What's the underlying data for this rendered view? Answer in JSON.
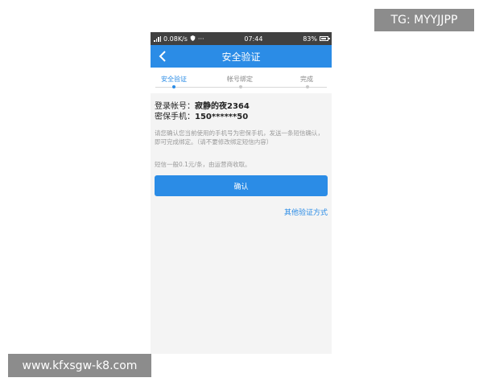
{
  "watermarks": {
    "tg": "TG: MYYJJPP",
    "site": "www.kfxsgw-k8.com"
  },
  "status_bar": {
    "network_speed": "0.08K/s",
    "extra": "···",
    "time": "07:44",
    "battery": "83%"
  },
  "nav": {
    "title": "安全验证",
    "back_icon": "chevron-left-icon"
  },
  "steps": [
    {
      "label": "安全验证",
      "active": true
    },
    {
      "label": "帐号绑定",
      "active": false
    },
    {
      "label": "完成",
      "active": false
    }
  ],
  "account": {
    "label": "登录帐号：",
    "value": "寂静的夜2364"
  },
  "phone": {
    "label": "密保手机：",
    "value": "150******50"
  },
  "hint": "请您确认您当前使用的手机号为密保手机，发送一条短信确认，即可完成绑定。（请不要修改绑定短信内容）",
  "fee_note": "短信一般0.1元/条，由运营商收取。",
  "confirm_label": "确认",
  "other_method": "其他验证方式",
  "colors": {
    "accent": "#2b8ce6",
    "status_bar": "#404040"
  }
}
